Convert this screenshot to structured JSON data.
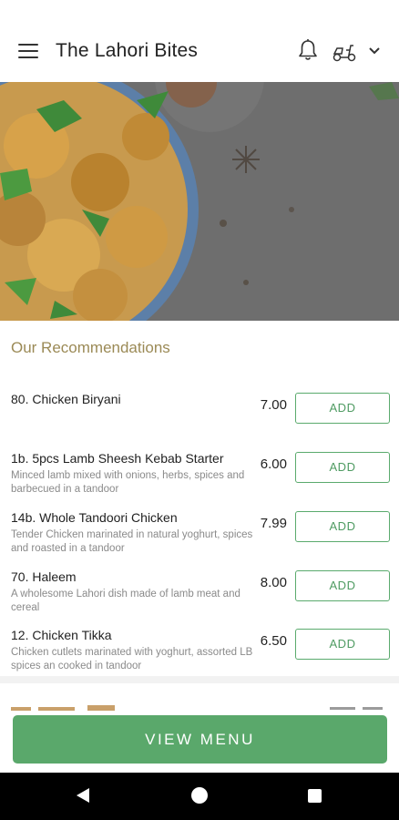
{
  "header": {
    "title": "The Lahori Bites",
    "icons": [
      "menu-icon",
      "bell-icon",
      "scooter-icon",
      "chevron-down-icon"
    ]
  },
  "recommendations": {
    "title": "Our Recommendations",
    "items": [
      {
        "name": "80. Chicken Biryani",
        "desc": "",
        "price": "7.00",
        "add_label": "ADD"
      },
      {
        "name": "1b. 5pcs Lamb Sheesh Kebab Starter",
        "desc": "Minced lamb mixed with onions, herbs, spices and barbecued in a tandoor",
        "price": "6.00",
        "add_label": "ADD"
      },
      {
        "name": "14b. Whole Tandoori Chicken",
        "desc": "Tender Chicken marinated in natural yoghurt, spices and roasted in a tandoor",
        "price": "7.99",
        "add_label": "ADD"
      },
      {
        "name": "70. Haleem",
        "desc": "A wholesome Lahori dish made of lamb meat and cereal",
        "price": "8.00",
        "add_label": "ADD"
      },
      {
        "name": "12. Chicken Tikka",
        "desc": "Chicken cutlets marinated with yoghurt, assorted LB spices an cooked in tandoor",
        "price": "6.50",
        "add_label": "ADD"
      }
    ]
  },
  "view_menu_label": "VIEW MENU",
  "colors": {
    "accent": "#5aa86b",
    "section_title": "#9b8a56",
    "hero_overlay": "#6e6e6e"
  }
}
